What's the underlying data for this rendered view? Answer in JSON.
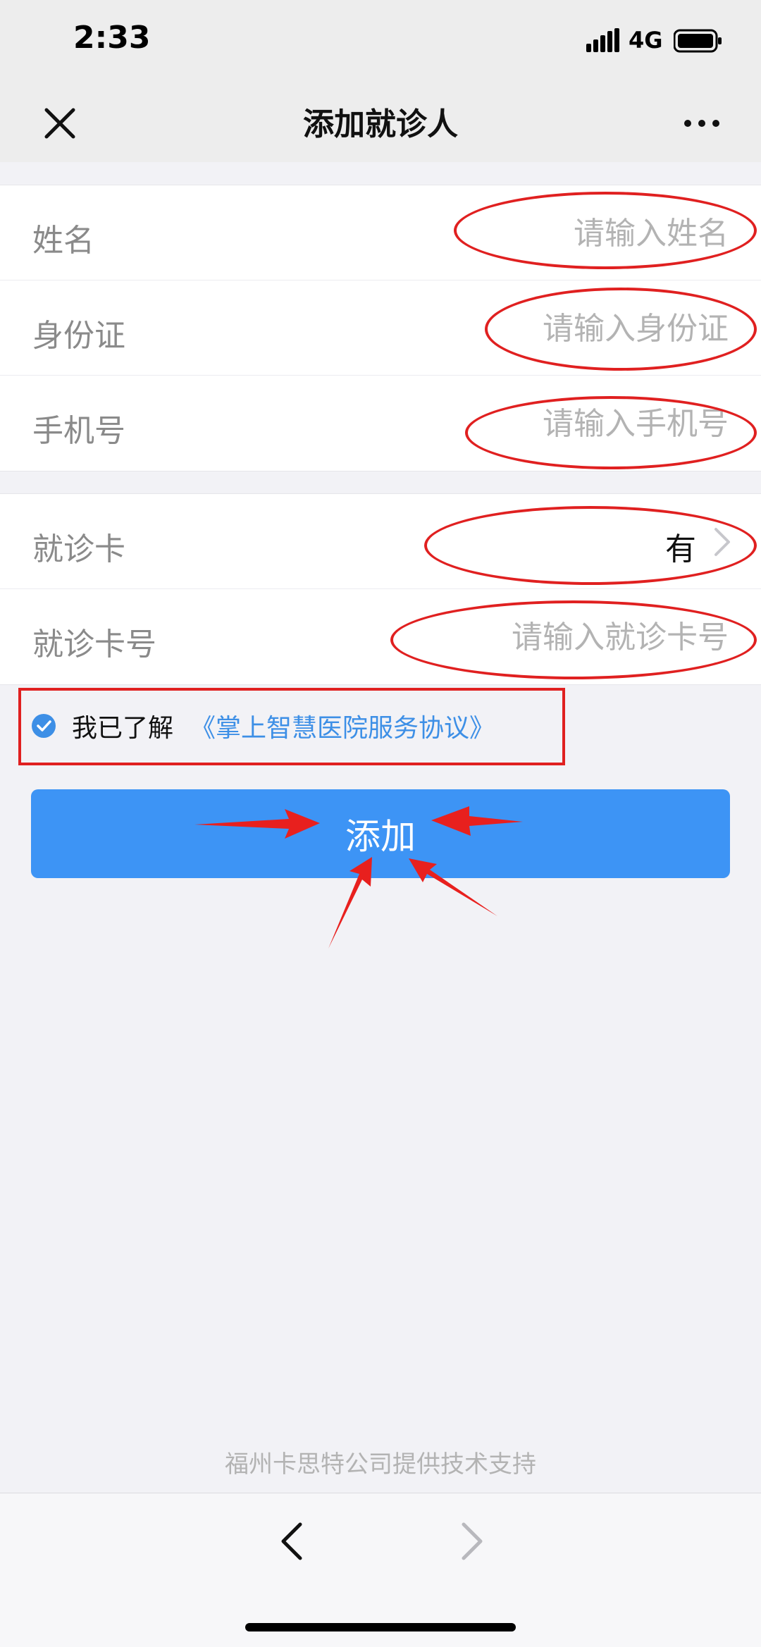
{
  "status_bar": {
    "time": "2:33",
    "network": "4G"
  },
  "nav": {
    "title": "添加就诊人",
    "close_icon": "close-icon",
    "more_icon": "more-icon"
  },
  "form": {
    "name": {
      "label": "姓名",
      "placeholder": "请输入姓名"
    },
    "id_card": {
      "label": "身份证",
      "placeholder": "请输入身份证"
    },
    "phone": {
      "label": "手机号",
      "placeholder": "请输入手机号"
    },
    "visit_card": {
      "label": "就诊卡",
      "value": "有"
    },
    "visit_card_number": {
      "label": "就诊卡号",
      "placeholder": "请输入就诊卡号"
    }
  },
  "agreement": {
    "checked": true,
    "text": "我已了解",
    "link": "《掌上智慧医院服务协议》"
  },
  "actions": {
    "add_label": "添加"
  },
  "footer": {
    "support_text": "福州卡思特公司提供技术支持"
  },
  "colors": {
    "primary": "#3d94f5",
    "link": "#3d8fe6",
    "annotation": "#e02020",
    "background": "#f2f2f6"
  }
}
